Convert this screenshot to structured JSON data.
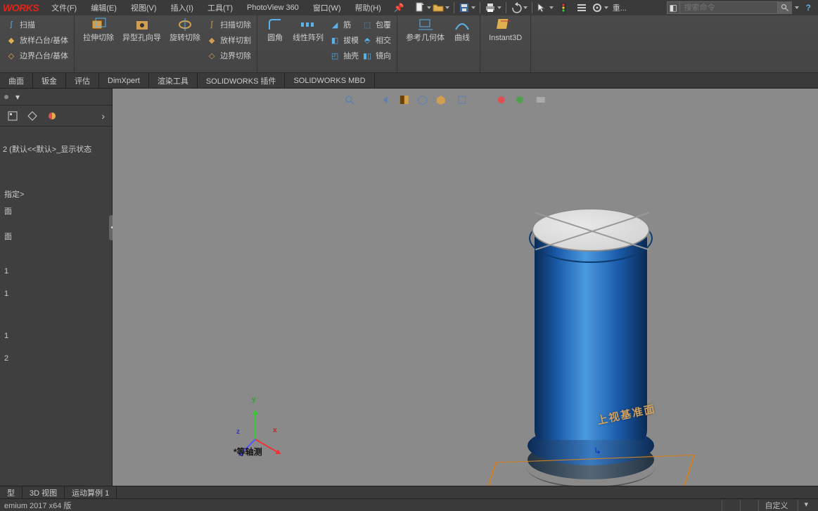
{
  "app": {
    "logo": "WORKS"
  },
  "menu": {
    "file": "文件(F)",
    "edit": "编辑(E)",
    "view": "视图(V)",
    "insert": "插入(I)",
    "tools": "工具(T)",
    "photoview": "PhotoView 360",
    "window": "窗口(W)",
    "help": "帮助(H)",
    "rebuild_label": "重..."
  },
  "search": {
    "placeholder": "搜索命令"
  },
  "ribbon": {
    "g1": {
      "sweep": "扫描",
      "loft": "放样凸台/基体",
      "boundary": "边界凸台/基体"
    },
    "g2": {
      "extcut": "拉伸切除",
      "holewiz": "异型孔向导",
      "revcut": "旋转切除",
      "sweepcut": "扫描切除",
      "loftcut": "放样切割",
      "boundcut": "边界切除"
    },
    "g3": {
      "fillet": "圆角",
      "linpat": "线性阵列",
      "rib": "筋",
      "wrap": "包覆",
      "draft": "拔模",
      "intersect": "相交",
      "shell": "抽壳",
      "mirror": "镜向"
    },
    "g4": {
      "refgeo": "参考几何体",
      "curves": "曲线"
    },
    "g5": {
      "instant3d": "Instant3D"
    }
  },
  "cmdtabs": {
    "surface": "曲面",
    "sheet": "钣金",
    "evaluate": "评估",
    "dimxpert": "DimXpert",
    "render": "渲染工具",
    "addins": "SOLIDWORKS 插件",
    "mbd": "SOLIDWORKS MBD"
  },
  "tree": {
    "config_line": "2 (默认<<默认>_显示状态",
    "annot": "指定>",
    "plane_a": "面",
    "plane_b": "面",
    "item1a": "1",
    "item1b": "1",
    "item1c": "1",
    "item2": "2"
  },
  "viewport": {
    "view_name": "*等轴测",
    "face_label": "上视基准面",
    "origin_glyph": "↳"
  },
  "triad_labels": {
    "x": "x",
    "y": "y",
    "z": "z"
  },
  "motiontabs": {
    "model": "型",
    "view3d": "3D 视图",
    "motion": "运动算例 1"
  },
  "status": {
    "version": "emium 2017 x64 版",
    "custom": "自定义"
  }
}
